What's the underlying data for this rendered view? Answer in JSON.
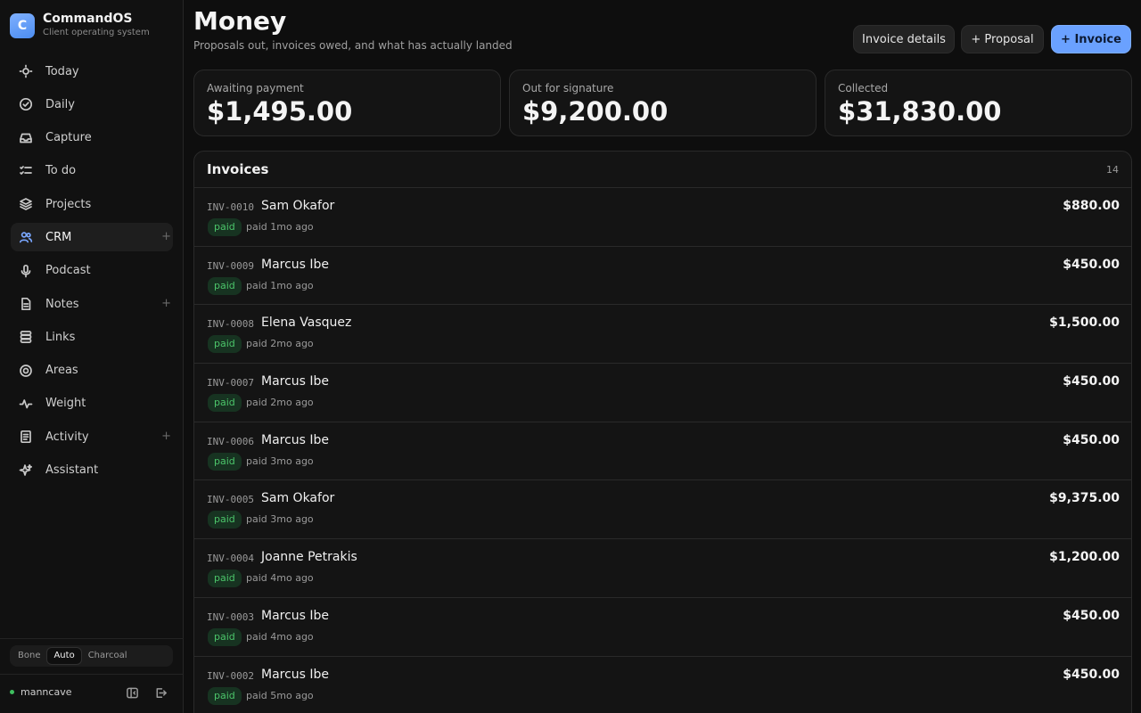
{
  "brand": {
    "logo_letter": "C",
    "name": "CommandOS",
    "tagline": "Client operating system",
    "accent": "#6aa1ff"
  },
  "sidebar": {
    "items": [
      {
        "label": "Today",
        "icon": "sun-icon",
        "plus": false,
        "active": false
      },
      {
        "label": "Daily",
        "icon": "check-circle-icon",
        "plus": false,
        "active": false
      },
      {
        "label": "Capture",
        "icon": "inbox-icon",
        "plus": false,
        "active": false
      },
      {
        "label": "To do",
        "icon": "checklist-icon",
        "plus": false,
        "active": false
      },
      {
        "label": "Projects",
        "icon": "layers-icon",
        "plus": false,
        "active": false
      },
      {
        "label": "CRM",
        "icon": "users-icon",
        "plus": true,
        "active": true
      },
      {
        "label": "Podcast",
        "icon": "microphone-icon",
        "plus": false,
        "active": false
      },
      {
        "label": "Notes",
        "icon": "file-icon",
        "plus": true,
        "active": false
      },
      {
        "label": "Links",
        "icon": "stack-icon",
        "plus": false,
        "active": false
      },
      {
        "label": "Areas",
        "icon": "target-icon",
        "plus": false,
        "active": false
      },
      {
        "label": "Weight",
        "icon": "pulse-icon",
        "plus": false,
        "active": false
      },
      {
        "label": "Activity",
        "icon": "document-list-icon",
        "plus": true,
        "active": false
      },
      {
        "label": "Assistant",
        "icon": "sparkles-icon",
        "plus": false,
        "active": false
      }
    ],
    "plus_label": "+",
    "theme_options": [
      "Bone",
      "Auto",
      "Charcoal"
    ],
    "theme_selected": "Auto",
    "user": {
      "name": "manncave",
      "status_color": "#3fbf5f"
    }
  },
  "header": {
    "title": "Money",
    "subtitle": "Proposals out, invoices owed, and what has actually landed",
    "buttons": {
      "details": "Invoice details",
      "proposal": "+ Proposal",
      "invoice": "+ Invoice"
    }
  },
  "stats": [
    {
      "label": "Awaiting payment",
      "value": "$1,495.00"
    },
    {
      "label": "Out for signature",
      "value": "$9,200.00"
    },
    {
      "label": "Collected",
      "value": "$31,830.00"
    }
  ],
  "invoices": {
    "title": "Invoices",
    "count": "14",
    "rows": [
      {
        "id": "INV-0010",
        "client": "Sam Okafor",
        "status": "paid",
        "when": "paid 1mo ago",
        "amount": "$880.00"
      },
      {
        "id": "INV-0009",
        "client": "Marcus Ibe",
        "status": "paid",
        "when": "paid 1mo ago",
        "amount": "$450.00"
      },
      {
        "id": "INV-0008",
        "client": "Elena Vasquez",
        "status": "paid",
        "when": "paid 2mo ago",
        "amount": "$1,500.00"
      },
      {
        "id": "INV-0007",
        "client": "Marcus Ibe",
        "status": "paid",
        "when": "paid 2mo ago",
        "amount": "$450.00"
      },
      {
        "id": "INV-0006",
        "client": "Marcus Ibe",
        "status": "paid",
        "when": "paid 3mo ago",
        "amount": "$450.00"
      },
      {
        "id": "INV-0005",
        "client": "Sam Okafor",
        "status": "paid",
        "when": "paid 3mo ago",
        "amount": "$9,375.00"
      },
      {
        "id": "INV-0004",
        "client": "Joanne Petrakis",
        "status": "paid",
        "when": "paid 4mo ago",
        "amount": "$1,200.00"
      },
      {
        "id": "INV-0003",
        "client": "Marcus Ibe",
        "status": "paid",
        "when": "paid 4mo ago",
        "amount": "$450.00"
      },
      {
        "id": "INV-0002",
        "client": "Marcus Ibe",
        "status": "paid",
        "when": "paid 5mo ago",
        "amount": "$450.00"
      }
    ]
  }
}
